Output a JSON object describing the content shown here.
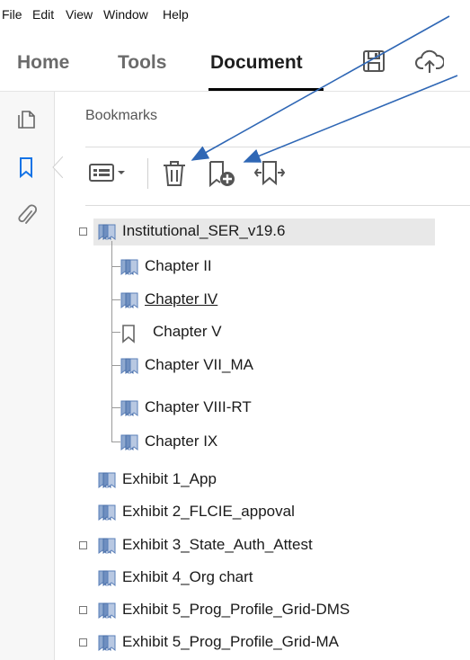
{
  "menubar": {
    "items": [
      "File",
      "Edit",
      "View",
      "Window",
      "Help"
    ]
  },
  "tabs": {
    "home": "Home",
    "tools": "Tools",
    "document": "Document"
  },
  "panel": {
    "title": "Bookmarks"
  },
  "bookmarks": [
    {
      "label": "Institutional_SER_v19.6",
      "level": 0,
      "expander": true,
      "selected": true,
      "icon": "bookmark-tree-icon"
    },
    {
      "label": "Chapter II",
      "level": 1,
      "icon": "bookmark-tree-icon"
    },
    {
      "label": "Chapter IV",
      "level": 1,
      "icon": "bookmark-tree-icon",
      "underlined": true
    },
    {
      "label": "Chapter V",
      "level": 1,
      "icon": "bookmark-empty-icon"
    },
    {
      "label": "Chapter VII_MA",
      "level": 1,
      "icon": "bookmark-tree-icon"
    },
    {
      "label": "Chapter VIII-RT",
      "level": 1,
      "icon": "bookmark-tree-icon"
    },
    {
      "label": "Chapter IX",
      "level": 1,
      "icon": "bookmark-tree-icon"
    },
    {
      "label": "Exhibit 1_App",
      "level": 0,
      "icon": "bookmark-tree-icon"
    },
    {
      "label": "Exhibit 2_FLCIE_appoval",
      "level": 0,
      "icon": "bookmark-tree-icon"
    },
    {
      "label": "Exhibit 3_State_Auth_Attest",
      "level": 0,
      "expander": true,
      "icon": "bookmark-tree-icon"
    },
    {
      "label": "Exhibit 4_Org chart",
      "level": 0,
      "icon": "bookmark-tree-icon"
    },
    {
      "label": "Exhibit 5_Prog_Profile_Grid-DMS",
      "level": 0,
      "expander": true,
      "icon": "bookmark-tree-icon"
    },
    {
      "label": "Exhibit 5_Prog_Profile_Grid-MA",
      "level": 0,
      "expander": true,
      "icon": "bookmark-tree-icon"
    }
  ],
  "colors": {
    "accent": "#1473e6",
    "arrow": "#2f67b5",
    "bookmark_blue": "#5a7fb8"
  }
}
